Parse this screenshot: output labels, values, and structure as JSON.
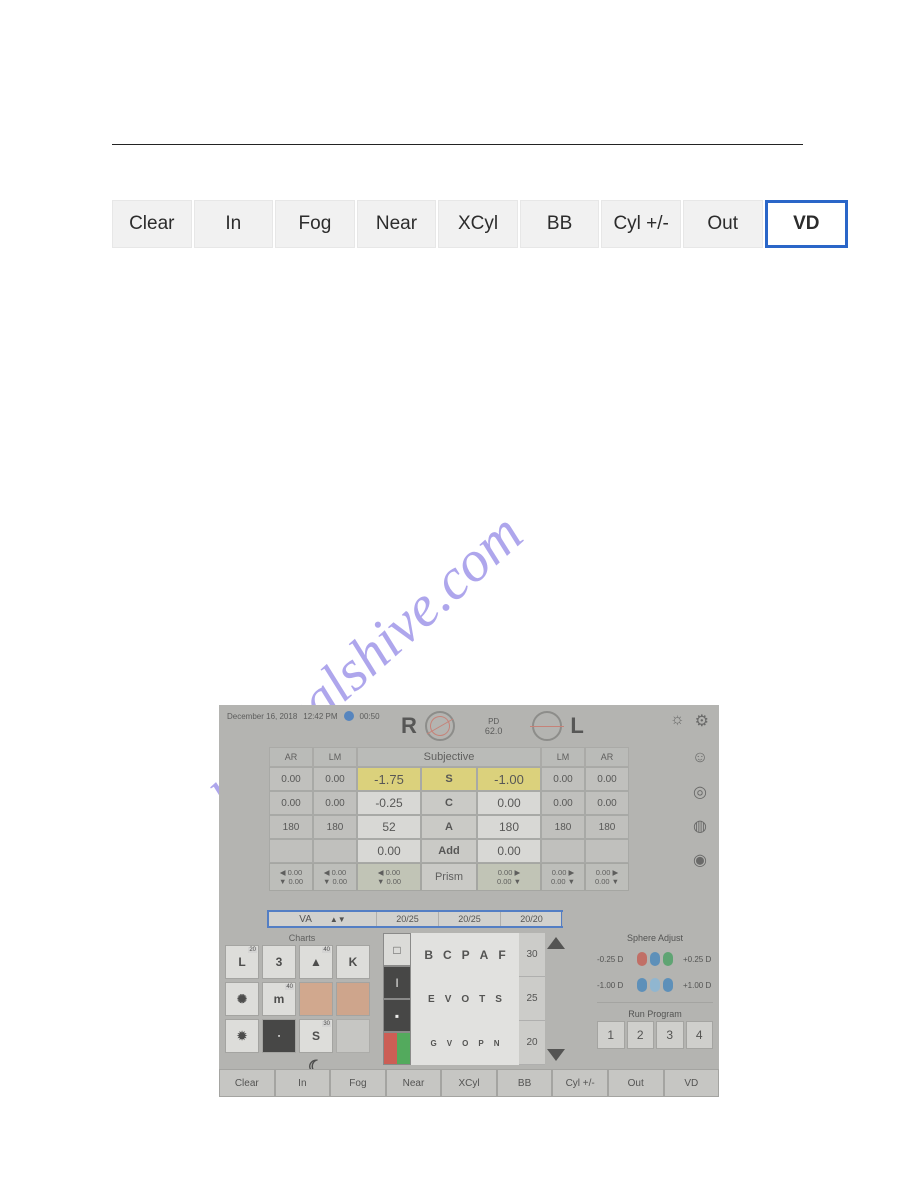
{
  "watermark": "manualshive.com",
  "top_bar": {
    "buttons": [
      "Clear",
      "In",
      "Fog",
      "Near",
      "XCyl",
      "BB",
      "Cyl +/-",
      "Out",
      "VD"
    ],
    "selected_index": 8
  },
  "app": {
    "status": {
      "date": "December 16, 2018",
      "time": "12:42 PM",
      "timer": "00:50"
    },
    "header": {
      "right_eye": "R",
      "left_eye": "L",
      "pd_label": "PD",
      "pd_value": "62.0"
    },
    "icons": {
      "brightness": "brightness-icon",
      "settings": "gear-icon",
      "face": "face-icon",
      "target": "target-icon",
      "hatch": "hatch-icon",
      "disc": "disc-icon"
    },
    "table": {
      "head": {
        "outer_r": [
          "AR",
          "LM"
        ],
        "center": "Subjective",
        "outer_l": [
          "LM",
          "AR"
        ]
      },
      "rows": [
        {
          "outer_r": [
            "0.00",
            "0.00"
          ],
          "r": "-1.75",
          "lbl": "S",
          "l": "-1.00",
          "outer_l": [
            "0.00",
            "0.00"
          ],
          "hl": true
        },
        {
          "outer_r": [
            "0.00",
            "0.00"
          ],
          "r": "-0.25",
          "lbl": "C",
          "l": "0.00",
          "outer_l": [
            "0.00",
            "0.00"
          ]
        },
        {
          "outer_r": [
            "180",
            "180"
          ],
          "r": "52",
          "lbl": "A",
          "l": "180",
          "outer_l": [
            "180",
            "180"
          ]
        },
        {
          "outer_r": [
            "",
            ""
          ],
          "r": "0.00",
          "lbl": "Add",
          "l": "0.00",
          "outer_l": [
            "",
            ""
          ]
        }
      ],
      "prism": {
        "label": "Prism",
        "outer_r_top": "0.00",
        "outer_r2_top": "0.00",
        "r_top": "0.00",
        "l_top": "0.00",
        "outer_l_top": "0.00",
        "outer_l2_top": "0.00",
        "outer_r_bot": "0.00",
        "outer_r2_bot": "0.00",
        "r_bot": "0.00",
        "l_bot": "0.00",
        "outer_l_bot": "0.00",
        "outer_l2_bot": "0.00"
      },
      "va": {
        "label": "VA",
        "r": "20/25",
        "c": "20/25",
        "l": "20/20"
      }
    },
    "charts": {
      "title": "Charts",
      "grid": [
        {
          "label": "L",
          "corner": "20"
        },
        {
          "label": "3",
          "corner": ""
        },
        {
          "label": "",
          "corner": "40",
          "tree": true
        },
        {
          "label": "K",
          "corner": ""
        },
        {
          "label": "",
          "burst": true
        },
        {
          "label": "m",
          "corner": "40"
        },
        {
          "label": "",
          "face": true
        },
        {
          "label": "",
          "patch": true
        },
        {
          "label": "",
          "sunburst": true
        },
        {
          "label": "",
          "dark": true
        },
        {
          "label": "S",
          "corner": "30",
          "stack": true
        },
        {
          "label": "",
          "empty": true
        }
      ],
      "extra": {
        "moon": "moon-icon",
        "dots": "…"
      }
    },
    "letters": {
      "rows": [
        {
          "letters": [
            "B",
            "C",
            "P",
            "A",
            "F"
          ],
          "size": "30"
        },
        {
          "letters": [
            "E",
            "V",
            "O",
            "T",
            "S"
          ],
          "size": "25"
        },
        {
          "letters": [
            "G",
            "V",
            "O",
            "P",
            "N"
          ],
          "size": "20"
        }
      ],
      "left_tiles": [
        "white-square",
        "black-I",
        "black-dot",
        "red-green"
      ]
    },
    "sphere": {
      "title": "Sphere Adjust",
      "row1": {
        "left": "-0.25 D",
        "right": "+0.25 D"
      },
      "row2": {
        "left": "-1.00 D",
        "right": "+1.00 D"
      },
      "run_title": "Run Program",
      "run_buttons": [
        "1",
        "2",
        "3",
        "4"
      ]
    },
    "bottom_bar": [
      "Clear",
      "In",
      "Fog",
      "Near",
      "XCyl",
      "BB",
      "Cyl +/-",
      "Out",
      "VD"
    ]
  }
}
